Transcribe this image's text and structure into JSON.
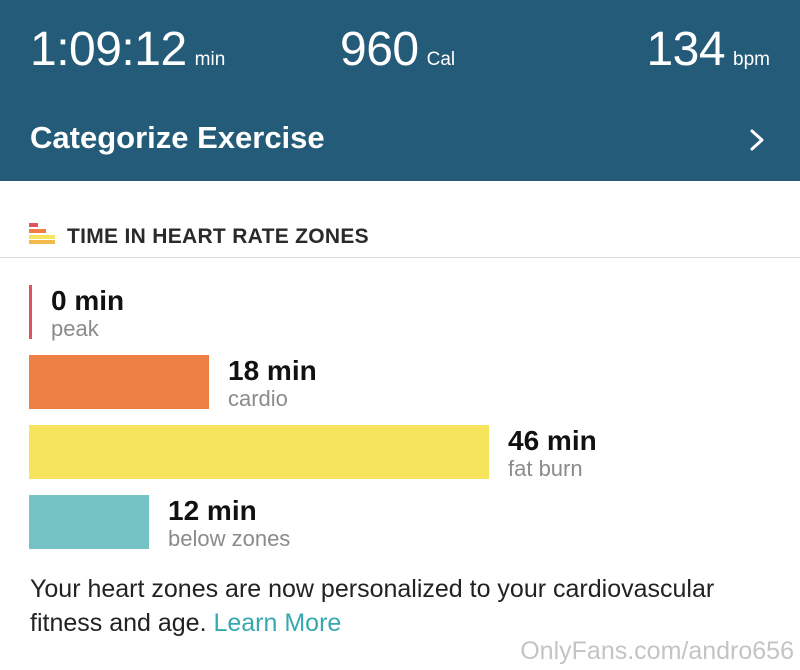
{
  "stats": {
    "duration": {
      "value": "1:09:12",
      "unit": "min"
    },
    "calories": {
      "value": "960",
      "unit": "Cal"
    },
    "heart_rate": {
      "value": "134",
      "unit": "bpm"
    }
  },
  "categorize": {
    "label": "Categorize Exercise"
  },
  "zones_section": {
    "title": "TIME IN HEART RATE ZONES",
    "zones": [
      {
        "value": "0 min",
        "label": "peak",
        "minutes": 0,
        "color": "#e0525f"
      },
      {
        "value": "18 min",
        "label": "cardio",
        "minutes": 18,
        "color": "#ee8046"
      },
      {
        "value": "46 min",
        "label": "fat burn",
        "minutes": 46,
        "color": "#f6e45c"
      },
      {
        "value": "12 min",
        "label": "below zones",
        "minutes": 12,
        "color": "#74c2c4"
      }
    ]
  },
  "footer": {
    "text": "Your heart zones are now personalized to your cardiovascular fitness and age.",
    "link": "Learn More"
  },
  "watermark": "OnlyFans.com/andro656",
  "colors": {
    "header_bg": "#245b78",
    "link": "#35a9b0"
  }
}
